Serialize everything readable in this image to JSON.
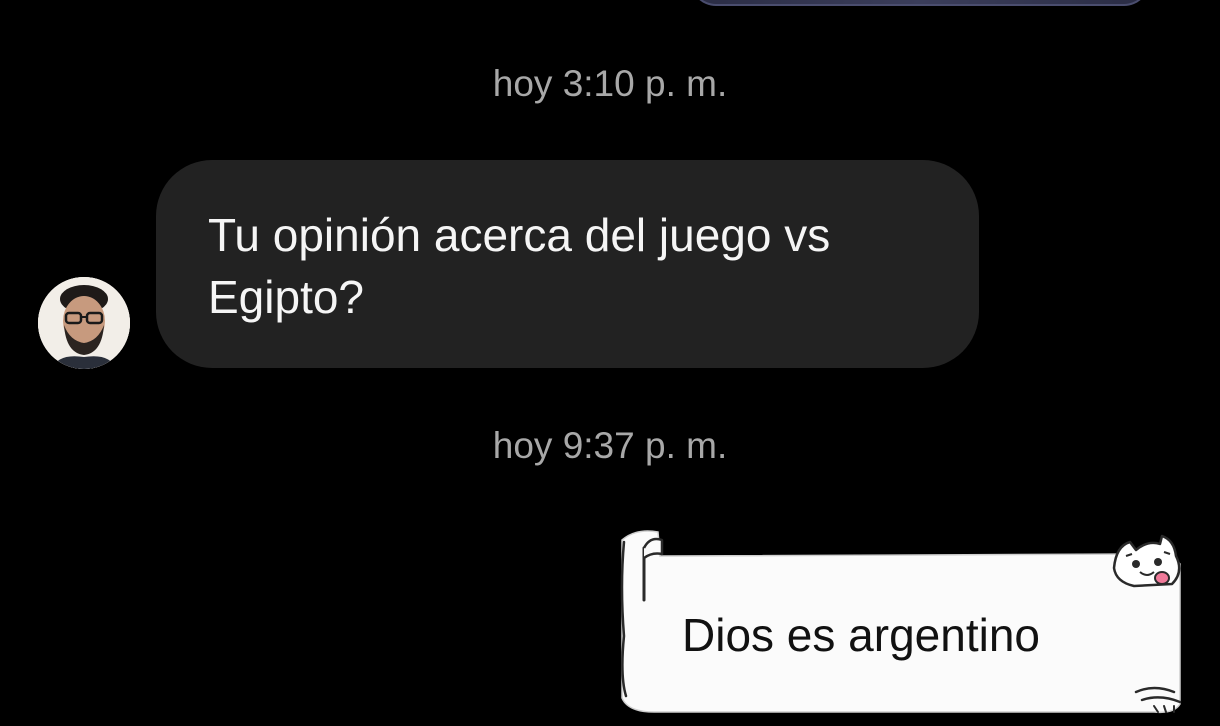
{
  "conversation": {
    "messages": [
      {
        "timestamp": "hoy 3:10 p. m.",
        "sender": "other",
        "text": "Tu opinión acerca del juego vs Egipto?"
      },
      {
        "timestamp": "hoy 9:37 p. m.",
        "sender": "me",
        "text": "Dios es argentino"
      }
    ]
  },
  "colors": {
    "background": "#000000",
    "incoming_bubble": "#222222",
    "timestamp": "#a8a8a8",
    "outgoing_bubble": "#ffffff"
  }
}
